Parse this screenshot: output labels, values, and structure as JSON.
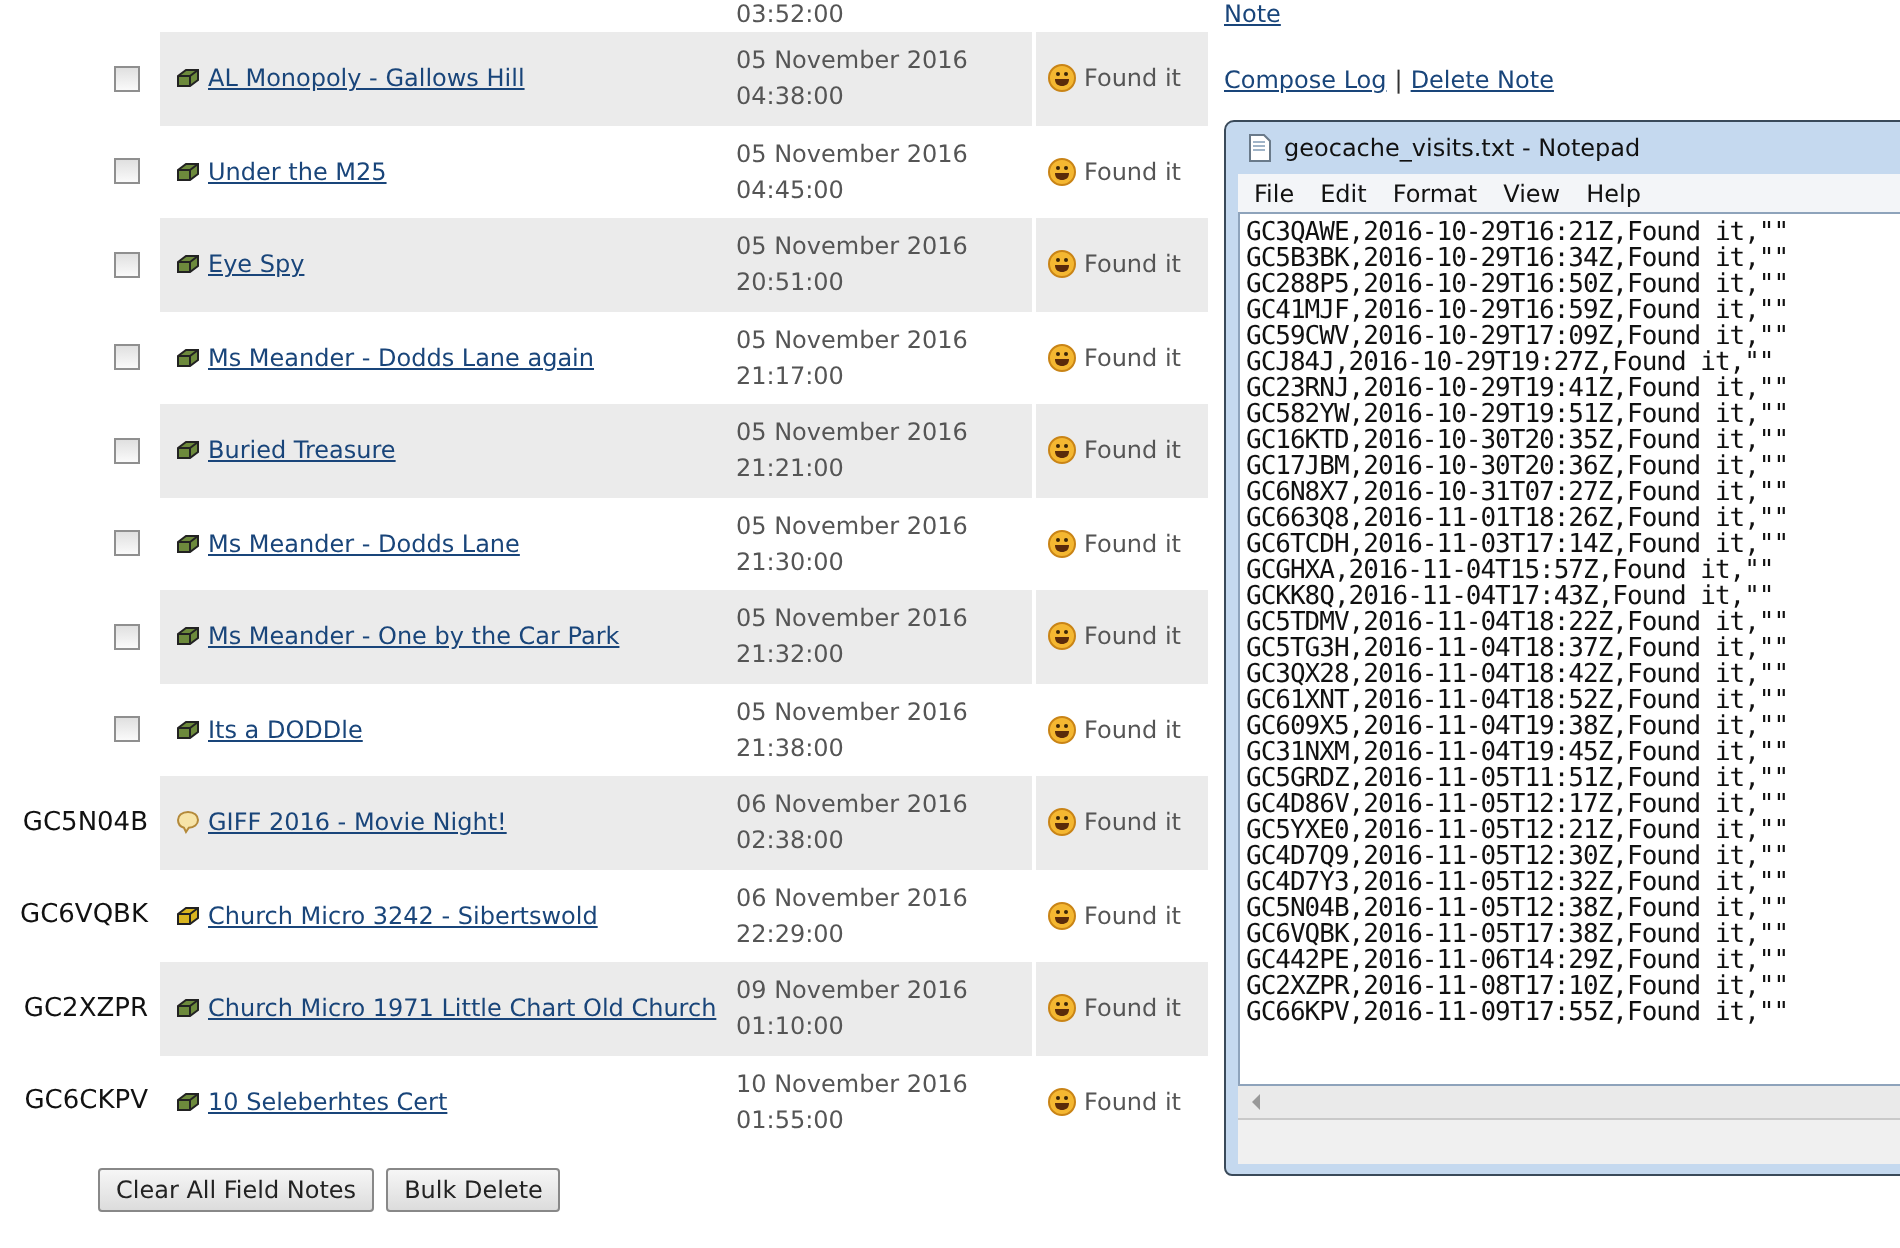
{
  "partial_row": {
    "time": "03:52:00",
    "action": "Note"
  },
  "rows": [
    {
      "kind": "traditional",
      "checked": false,
      "name": "AL Monopoly - Gallows Hill",
      "date": "05 November 2016",
      "time": "04:38:00",
      "log": "Found it",
      "actions": [
        "Compose Log",
        "Delete Note"
      ],
      "separator": "|"
    },
    {
      "kind": "traditional",
      "checked": false,
      "name": "Under the M25",
      "date": "05 November 2016",
      "time": "04:45:00",
      "log": "Found it"
    },
    {
      "kind": "traditional",
      "checked": false,
      "name": "Eye Spy",
      "date": "05 November 2016",
      "time": "20:51:00",
      "log": "Found it"
    },
    {
      "kind": "traditional",
      "checked": false,
      "name": "Ms Meander - Dodds Lane again",
      "date": "05 November 2016",
      "time": "21:17:00",
      "log": "Found it"
    },
    {
      "kind": "traditional",
      "checked": false,
      "name": "Buried Treasure",
      "date": "05 November 2016",
      "time": "21:21:00",
      "log": "Found it"
    },
    {
      "kind": "traditional",
      "checked": false,
      "name": "Ms Meander - Dodds Lane",
      "date": "05 November 2016",
      "time": "21:30:00",
      "log": "Found it"
    },
    {
      "kind": "traditional",
      "checked": false,
      "name": "Ms Meander - One by the Car Park",
      "date": "05 November 2016",
      "time": "21:32:00",
      "log": "Found it"
    },
    {
      "kind": "traditional",
      "checked": false,
      "name": "Its a DODDle",
      "date": "05 November 2016",
      "time": "21:38:00",
      "log": "Found it"
    },
    {
      "kind": "event",
      "code": "GC5N04B",
      "name": "GIFF 2016 - Movie Night!",
      "date": "06 November 2016",
      "time": "02:38:00",
      "log": "Found it"
    },
    {
      "kind": "micro",
      "code": "GC6VQBK",
      "name": "Church Micro 3242 - Sibertswold",
      "date": "06 November 2016",
      "time": "22:29:00",
      "log": "Found it"
    },
    {
      "kind": "traditional",
      "code": "GC2XZPR",
      "name": "Church Micro 1971 Little Chart Old Church",
      "date": "09 November 2016",
      "time": "01:10:00",
      "log": "Found it"
    },
    {
      "kind": "traditional",
      "code": "GC6CKPV",
      "name": "10 Seleberhtes Cert",
      "date": "10 November 2016",
      "time": "01:55:00",
      "log": "Found it"
    }
  ],
  "buttons": [
    "Clear All Field Notes",
    "Bulk Delete"
  ],
  "notepad": {
    "title": "geocache_visits.txt - Notepad",
    "menu": [
      "File",
      "Edit",
      "Format",
      "View",
      "Help"
    ],
    "lines": [
      "GC3QAWE,2016-10-29T16:21Z,Found it,\"\"",
      "GC5B3BK,2016-10-29T16:34Z,Found it,\"\"",
      "GC288P5,2016-10-29T16:50Z,Found it,\"\"",
      "GC41MJF,2016-10-29T16:59Z,Found it,\"\"",
      "GC59CWV,2016-10-29T17:09Z,Found it,\"\"",
      "GCJ84J,2016-10-29T19:27Z,Found it,\"\"",
      "GC23RNJ,2016-10-29T19:41Z,Found it,\"\"",
      "GC582YW,2016-10-29T19:51Z,Found it,\"\"",
      "GC16KTD,2016-10-30T20:35Z,Found it,\"\"",
      "GC17JBM,2016-10-30T20:36Z,Found it,\"\"",
      "GC6N8X7,2016-10-31T07:27Z,Found it,\"\"",
      "GC663Q8,2016-11-01T18:26Z,Found it,\"\"",
      "GC6TCDH,2016-11-03T17:14Z,Found it,\"\"",
      "GCGHXA,2016-11-04T15:57Z,Found it,\"\"",
      "GCKK8Q,2016-11-04T17:43Z,Found it,\"\"",
      "GC5TDMV,2016-11-04T18:22Z,Found it,\"\"",
      "GC5TG3H,2016-11-04T18:37Z,Found it,\"\"",
      "GC3QX28,2016-11-04T18:42Z,Found it,\"\"",
      "GC61XNT,2016-11-04T18:52Z,Found it,\"\"",
      "GC609X5,2016-11-04T19:38Z,Found it,\"\"",
      "GC31NXM,2016-11-04T19:45Z,Found it,\"\"",
      "GC5GRDZ,2016-11-05T11:51Z,Found it,\"\"",
      "GC4D86V,2016-11-05T12:17Z,Found it,\"\"",
      "GC5YXE0,2016-11-05T12:21Z,Found it,\"\"",
      "GC4D7Q9,2016-11-05T12:30Z,Found it,\"\"",
      "GC4D7Y3,2016-11-05T12:32Z,Found it,\"\"",
      "GC5N04B,2016-11-05T12:38Z,Found it,\"\"",
      "GC6VQBK,2016-11-05T17:38Z,Found it,\"\"",
      "GC442PE,2016-11-06T14:29Z,Found it,\"\"",
      "GC2XZPR,2016-11-08T17:10Z,Found it,\"\"",
      "GC66KPV,2016-11-09T17:55Z,Found it,\"\""
    ]
  }
}
